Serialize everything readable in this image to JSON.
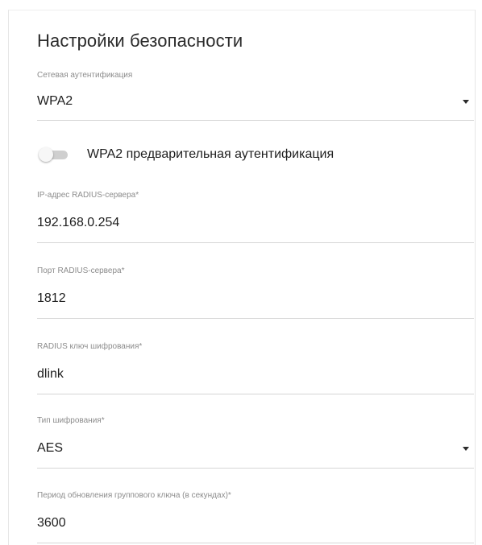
{
  "section": {
    "title": "Настройки безопасности"
  },
  "auth": {
    "label": "Сетевая аутентификация",
    "value": "WPA2"
  },
  "preauth": {
    "label": "WPA2 предварительная аутентификация",
    "enabled": false
  },
  "radius_ip": {
    "label": "IP-адрес RADIUS-сервера*",
    "value": "192.168.0.254"
  },
  "radius_port": {
    "label": "Порт RADIUS-сервера*",
    "value": "1812"
  },
  "radius_key": {
    "label": "RADIUS ключ шифрования*",
    "value": "dlink"
  },
  "encryption": {
    "label": "Тип шифрования*",
    "value": "AES"
  },
  "group_key": {
    "label": "Период обновления группового ключа (в секундах)*",
    "value": "3600"
  },
  "icons": {
    "select_arrow": "chevron-down-icon",
    "toggle": "toggle-switch"
  }
}
